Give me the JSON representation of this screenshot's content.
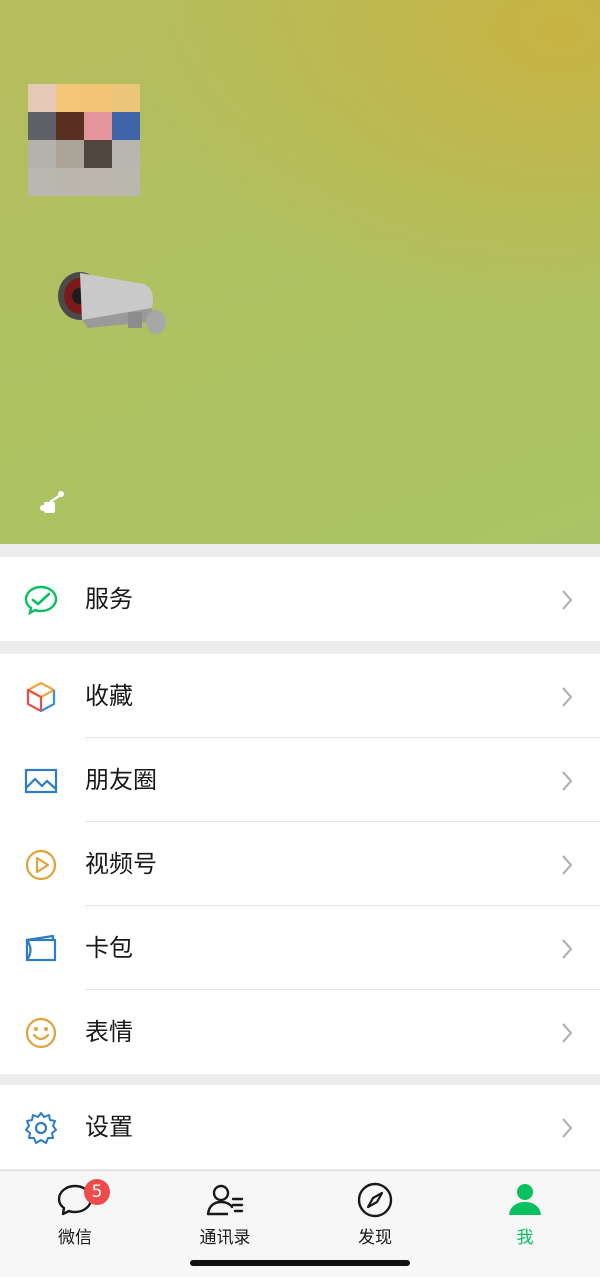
{
  "menu": {
    "service": {
      "label": "服务"
    },
    "favorites": {
      "label": "收藏"
    },
    "moments": {
      "label": "朋友圈"
    },
    "channels": {
      "label": "视频号"
    },
    "cards": {
      "label": "卡包"
    },
    "stickers": {
      "label": "表情"
    },
    "settings": {
      "label": "设置"
    }
  },
  "tabbar": {
    "chats": {
      "label": "微信",
      "badge": "5"
    },
    "contacts": {
      "label": "通讯录"
    },
    "discover": {
      "label": "发现"
    },
    "me": {
      "label": "我",
      "active": true
    }
  },
  "colors": {
    "accent": "#07c160",
    "badge": "#f04b4b",
    "header_top_right": "#c8b242",
    "header_base": "#abc264"
  },
  "icons": {
    "service": "wechat-pay-check-icon",
    "favorites": "cube-icon",
    "moments": "image-landscape-icon",
    "channels": "play-circle-icon",
    "cards": "card-wallet-icon",
    "stickers": "smiley-icon",
    "settings": "gear-icon"
  }
}
